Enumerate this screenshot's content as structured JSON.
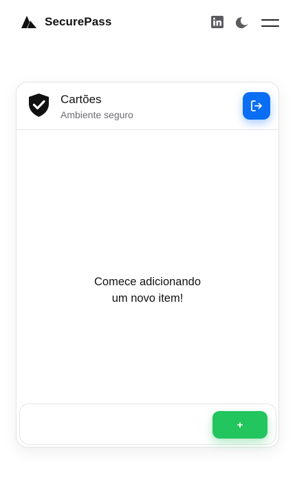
{
  "app": {
    "name": "SecurePass"
  },
  "topbar": {
    "icons": [
      "brand-logo-icon",
      "linkedin-icon",
      "moon-icon",
      "menu-icon"
    ]
  },
  "card": {
    "title": "Cartões",
    "subtitle": "Ambiente seguro",
    "empty_line1": "Comece adicionando",
    "empty_line2": "um novo item!",
    "add_label": "+"
  },
  "colors": {
    "primary": "#0a6ef5",
    "success": "#22c55e",
    "text": "#111111",
    "muted": "#6b6b72",
    "border": "#e4e4e7"
  }
}
